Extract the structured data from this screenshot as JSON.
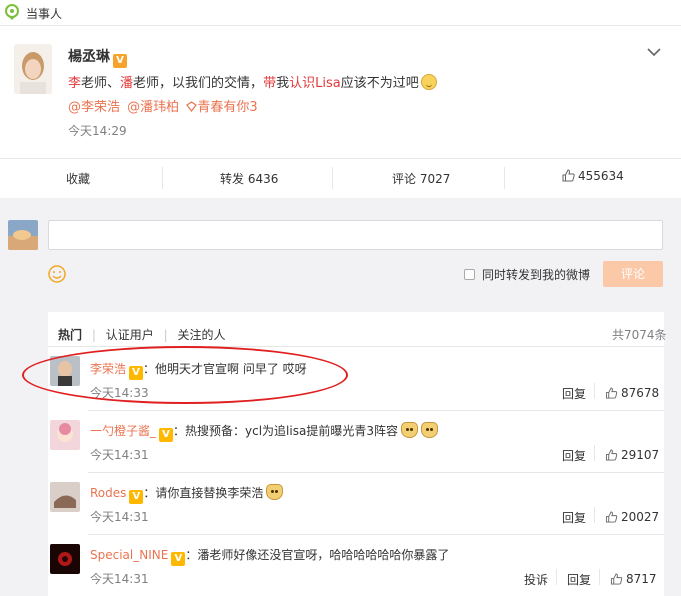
{
  "header": {
    "title": "当事人"
  },
  "post": {
    "author": "楊丞琳",
    "text_parts": [
      "李",
      "老师、",
      "潘",
      "老师，以我们的交情，",
      "带",
      "我",
      "认识",
      "Lisa",
      "应该不为过吧"
    ],
    "mentions": [
      "@李荣浩",
      "@潘玮柏"
    ],
    "topic": "青春有你3",
    "time": "今天14:29"
  },
  "actions": {
    "collect": "收藏",
    "repost": "转发 6436",
    "comment": "评论 7027",
    "like": "455634"
  },
  "composer": {
    "checkbox_label": "同时转发到我的微博",
    "submit_label": "评论"
  },
  "filters": {
    "hot": "热门",
    "verified": "认证用户",
    "following": "关注的人",
    "total": "共7074条"
  },
  "comments": [
    {
      "name": "李荣浩",
      "text": "：他明天才官宣啊 问早了 哎呀",
      "time": "今天14:33",
      "reply": "回复",
      "likes": "87678"
    },
    {
      "name": "一勺橙子酱_",
      "text": "：热搜预备：ycl为追lisa提前曝光青3阵容",
      "time": "今天14:31",
      "reply": "回复",
      "likes": "29107"
    },
    {
      "name": "Rodes",
      "text": "：请你直接替换李荣浩",
      "time": "今天14:31",
      "reply": "回复",
      "likes": "20027"
    },
    {
      "name": "Special_NINE",
      "text": "：潘老师好像还没官宣呀，哈哈哈哈哈哈你暴露了",
      "time": "今天14:31",
      "report": "投诉",
      "reply": "回复",
      "likes": "8717"
    }
  ],
  "colors": {
    "accent": "#eb7350",
    "annotation_circle": "#e02020",
    "submit_bg": "#fbc8a8"
  }
}
